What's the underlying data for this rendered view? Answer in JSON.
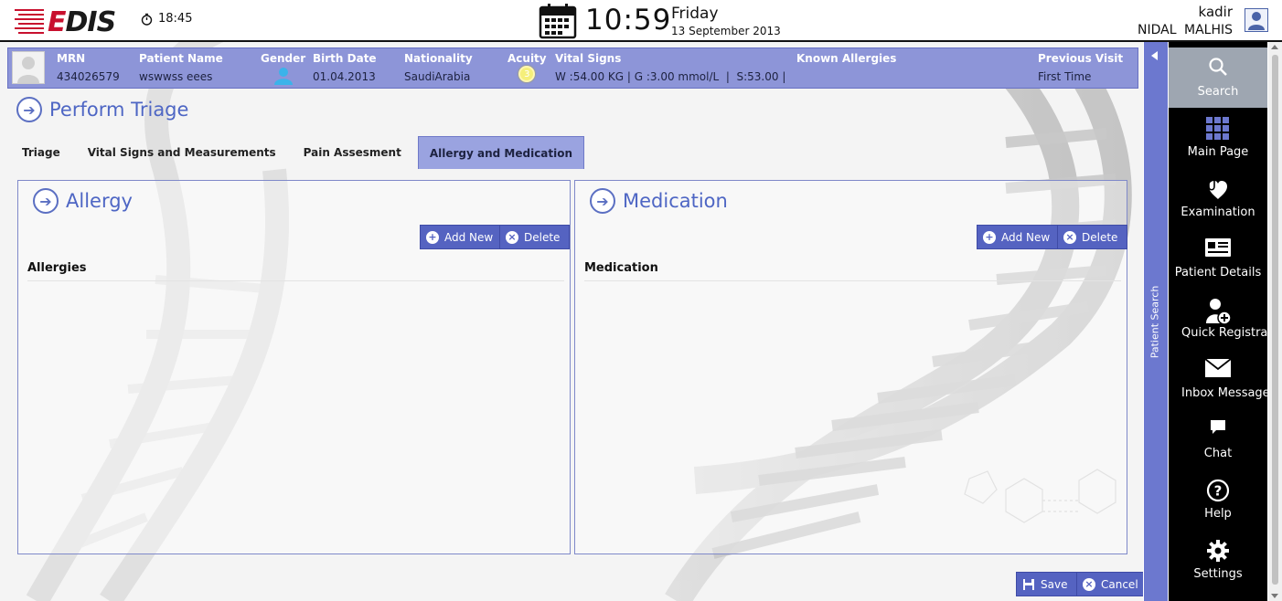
{
  "header": {
    "logo_text": "EDIS",
    "stopwatch_time": "18:45",
    "clock": "10:59",
    "day": "Friday",
    "date": "13 September 2013",
    "username": "kadir",
    "full_name": "NIDAL  MALHIS"
  },
  "patient": {
    "mrn_label": "MRN",
    "mrn": "434026579",
    "name_label": "Patient Name",
    "name": "wswwss eees",
    "gender_label": "Gender",
    "birth_label": "Birth Date",
    "birth": "01.04.2013",
    "nationality_label": "Nationality",
    "nationality": "SaudiArabia",
    "acuity_label": "Acuity",
    "acuity": "3",
    "vitals_label": "Vital Signs",
    "vitals": "W :54.00 KG | G :3.00 mmol/L  |  S:53.00 |",
    "allergies_label": "Known Allergies",
    "previous_label": "Previous Visit",
    "previous": "First Time"
  },
  "page": {
    "title": "Perform Triage"
  },
  "tabs": [
    {
      "label": "Triage",
      "active": false
    },
    {
      "label": "Vital Signs and Measurements",
      "active": false
    },
    {
      "label": "Pain Assesment",
      "active": false
    },
    {
      "label": "Allergy and Medication",
      "active": true
    }
  ],
  "allergy": {
    "title": "Allergy",
    "add_label": "Add New",
    "delete_label": "Delete",
    "list_header": "Allergies"
  },
  "medication": {
    "title": "Medication",
    "add_label": "Add New",
    "delete_label": "Delete",
    "list_header": "Medication"
  },
  "footer": {
    "save_label": "Save",
    "cancel_label": "Cancel"
  },
  "patient_search": {
    "label": "Patient Search"
  },
  "nav": [
    {
      "label": "Search",
      "icon": "search-icon",
      "active": true
    },
    {
      "label": "Main Page",
      "icon": "grid-icon",
      "active": false
    },
    {
      "label": "Examination",
      "icon": "stethoscope-icon",
      "active": false
    },
    {
      "label": "Patient Details",
      "icon": "id-card-icon",
      "active": false
    },
    {
      "label": "Quick Registration",
      "icon": "add-user-icon",
      "active": false
    },
    {
      "label": "Inbox Messages",
      "icon": "envelope-icon",
      "active": false
    },
    {
      "label": "Chat",
      "icon": "chat-icon",
      "active": false
    },
    {
      "label": "Help",
      "icon": "help-icon",
      "active": false
    },
    {
      "label": "Settings",
      "icon": "gear-icon",
      "active": false
    }
  ],
  "colors": {
    "accent": "#5563c1",
    "banner": "#8d95d8",
    "title": "#4e66c4",
    "nav_bg": "#000000",
    "nav_active": "#9ea6b1"
  }
}
